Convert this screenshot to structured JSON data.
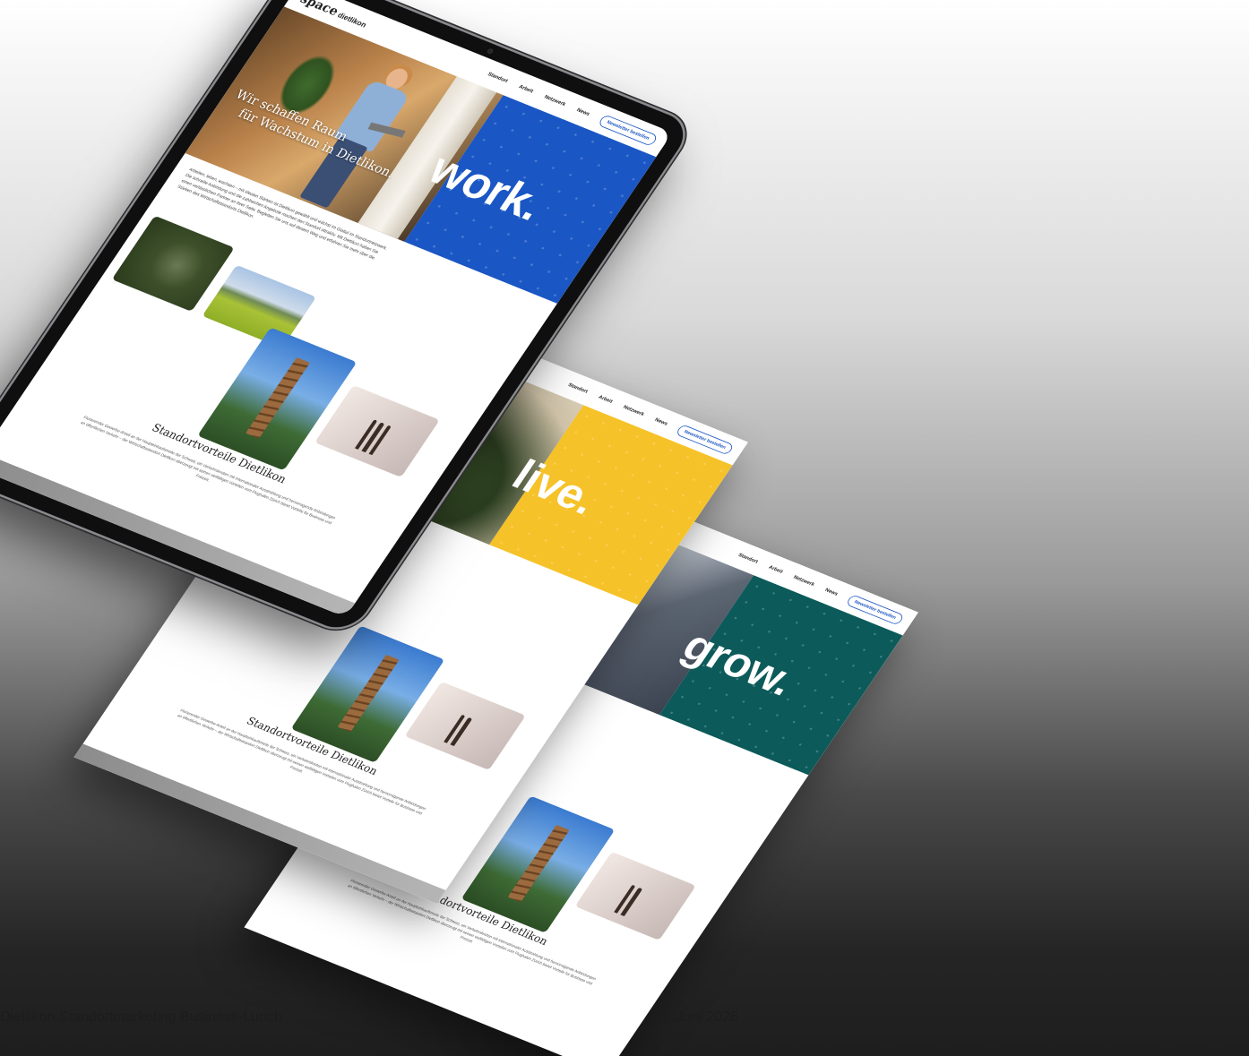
{
  "brand": {
    "logo_main": "space",
    "logo_sub": "dietlikon"
  },
  "nav": {
    "items": [
      "Standort",
      "Arbeit",
      "Netzwerk",
      "News"
    ],
    "cta": "Newsletter bestellen"
  },
  "hero": {
    "tagline_line1": "Wir schaffen Raum",
    "tagline_line2": "für Wachstum in Dietlikon."
  },
  "screens": [
    {
      "word": "work.",
      "color": "#1a56c4"
    },
    {
      "word": "live.",
      "color": "#f6c229"
    },
    {
      "word": "grow.",
      "color": "#0c5a5a"
    }
  ],
  "intro_text": "Arbeiten, leben, wachsen – mit idealen Stärken ist Dietlikon gewählt und wächst im Glattal im Standortnetzwerk. Die schnelle Anbindung und die zahlreichen Angebote machen den Standort attraktiv. Mit Dietlikon haben Sie einen verlässlichen Partner an Ihrer Seite. Begleiten Sie uns auf diesem Weg und erfahren Sie mehr über die Stärken des Wirtschaftsstandorts Dietlikon.",
  "section": {
    "title": "Standortvorteile Dietlikon",
    "text": "Florierender Gewerbe-Anteil an der Haupteinkaufsmeile der Schweiz, ein Verkehrsknoten mit internationaler Ausstrahlung und hervorragende Anbindungen an öffentlichen Verkehr – der Wirtschaftsstandort Dietlikon überzeugt mit seinen vielfältigen Vorteilen vom Flughafen Zürich bietet Vorteile für Business und Freizeit."
  },
  "footer": {
    "event": "Dietlikon Standortmarketing Business-Lunch",
    "date": "04. Juni 2026"
  }
}
